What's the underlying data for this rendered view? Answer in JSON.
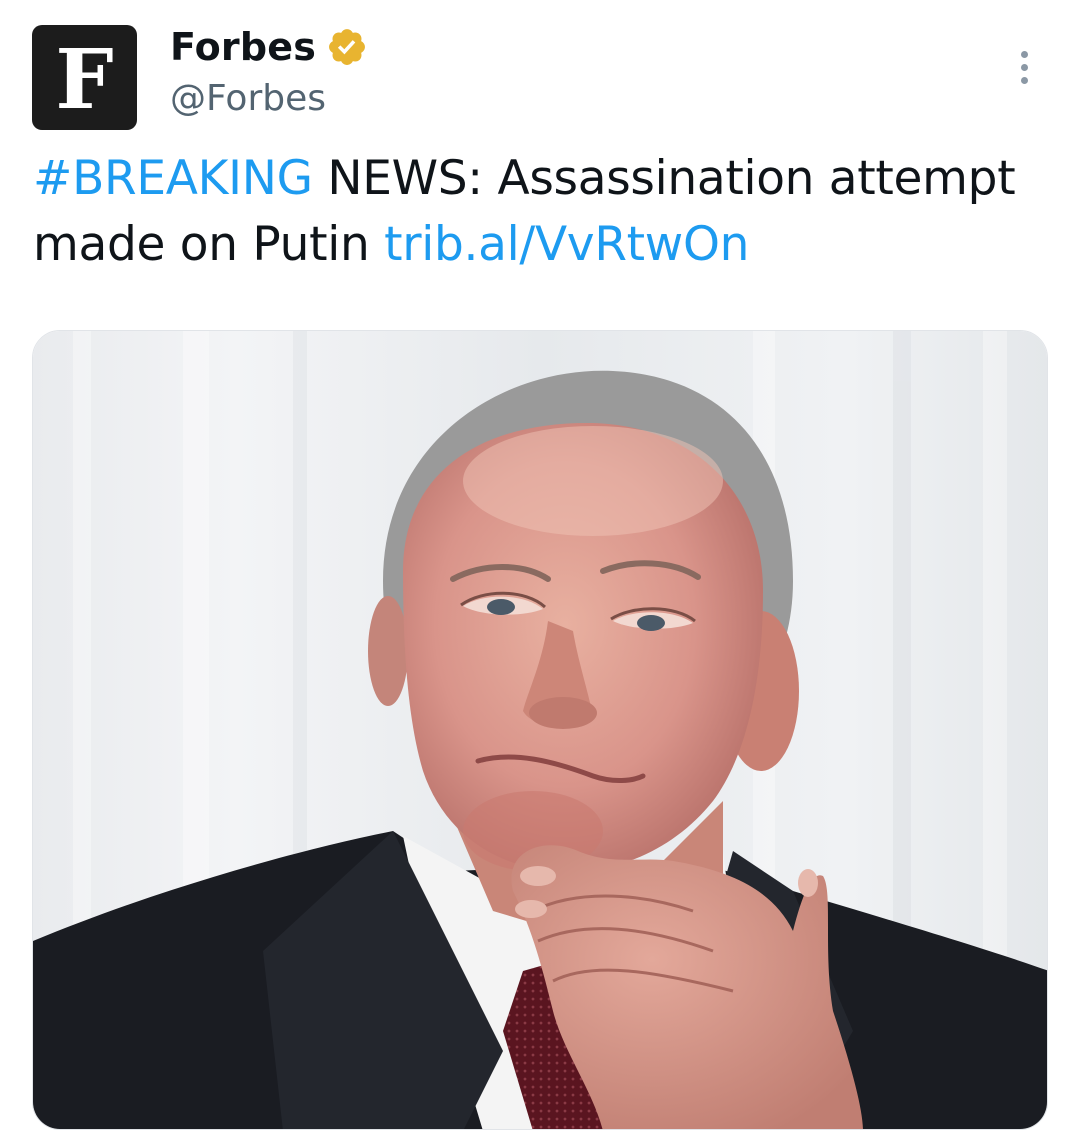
{
  "author": {
    "avatar_letter": "F",
    "display_name": "Forbes",
    "handle": "@Forbes",
    "verified_icon": "verified-gold-badge-icon"
  },
  "menu": {
    "icon": "more-vertical-icon"
  },
  "tweet": {
    "hashtag": "#BREAKING",
    "text_part1": " NEWS: Assassination attempt made on Putin ",
    "link": "trib.al/VvRtwOn"
  },
  "colors": {
    "link": "#1d9bf0",
    "verified_gold": "#e8b430",
    "handle_gray": "#536471"
  }
}
